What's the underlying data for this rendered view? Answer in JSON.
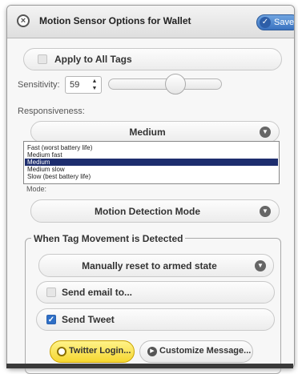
{
  "dialog": {
    "title": "Motion Sensor Options for Wallet",
    "save_label": "Save",
    "close_icon": "close-icon",
    "accent_color": "#3a72c0"
  },
  "apply_all": {
    "label": "Apply to All Tags",
    "checked": false
  },
  "sensitivity": {
    "label": "Sensitivity:",
    "value": "59"
  },
  "responsiveness": {
    "label": "Responsiveness:",
    "selected": "Medium",
    "options": [
      "Fast (worst battery life)",
      "Medium fast",
      "Medium",
      "Medium slow",
      "Slow (best battery life)"
    ],
    "selected_index": 2
  },
  "mode": {
    "label": "Mode:",
    "selected": "Motion Detection Mode"
  },
  "movement": {
    "legend": "When Tag Movement is Detected",
    "reset_select": "Manually reset to armed state",
    "send_email": {
      "label": "Send email to...",
      "checked": false
    },
    "send_tweet": {
      "label": "Send Tweet",
      "checked": true
    },
    "twitter_login": "Twitter Login...",
    "customize_message": "Customize Message..."
  }
}
